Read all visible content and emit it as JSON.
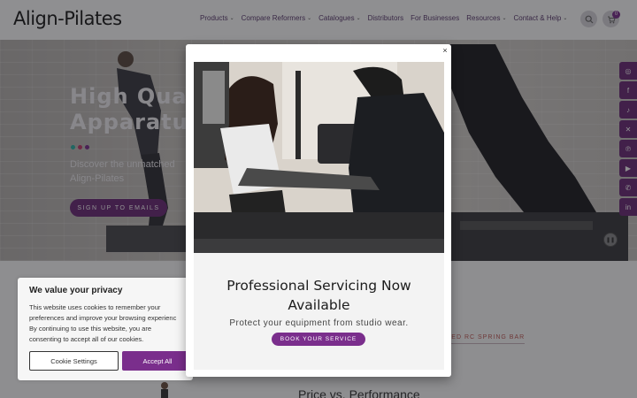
{
  "header": {
    "logo": "Align-Pilates",
    "nav": [
      {
        "label": "Products",
        "dropdown": true
      },
      {
        "label": "Compare Reformers",
        "dropdown": true
      },
      {
        "label": "Catalogues",
        "dropdown": true
      },
      {
        "label": "Distributors",
        "dropdown": false
      },
      {
        "label": "For Businesses",
        "dropdown": false
      },
      {
        "label": "Resources",
        "dropdown": true
      },
      {
        "label": "Contact & Help",
        "dropdown": true
      }
    ],
    "cart_count": "0",
    "search_icon": "search-icon",
    "cart_icon": "cart-icon"
  },
  "hero": {
    "title_line1": "High Qual",
    "title_line2": "Apparatus",
    "subtitle_line1": "Discover the unmatched",
    "subtitle_line2": "Align-Pilates",
    "button": "SIGN UP TO EMAILS",
    "dot_colors": [
      "#2bb3a6",
      "#c43b6c",
      "#7a2e8c"
    ],
    "pause_icon": "pause-icon"
  },
  "social": [
    "instagram-icon",
    "facebook-icon",
    "tiktok-icon",
    "x-icon",
    "pinterest-icon",
    "youtube-icon",
    "whatsapp-icon",
    "linkedin-icon"
  ],
  "below": {
    "spring_link": "TED RC SPRING BAR",
    "price_heading": "Price vs. Performance"
  },
  "cookie": {
    "title": "We value your privacy",
    "text": "This website uses cookies to remember your\npreferences and improve your browsing experienc\nBy continuing to use this website, you are\nconsenting to accept all of our cookies.",
    "settings_button": "Cookie Settings",
    "accept_button": "Accept All"
  },
  "modal": {
    "close": "×",
    "title_line1": "Professional Servicing Now",
    "title_line2": "Available",
    "subtitle": "Protect your equipment from studio wear.",
    "button": "BOOK YOUR SERVICE"
  },
  "colors": {
    "brand": "#7a2e8c",
    "nav_text": "#5a3a6e"
  }
}
